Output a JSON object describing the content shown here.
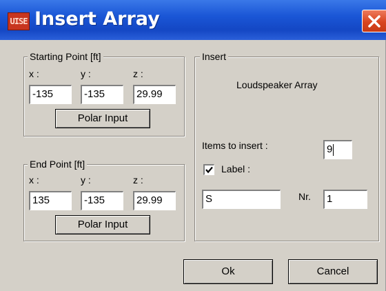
{
  "window": {
    "title": "Insert Array",
    "app_icon_text": "UISE",
    "close_icon": "close-x-icon",
    "accent_color": "#1a56d6",
    "close_color": "#d9451f"
  },
  "starting_point": {
    "legend": "Starting Point [ft]",
    "x_label": "x :",
    "y_label": "y :",
    "z_label": "z :",
    "x": "-135",
    "y": "-135",
    "z": "29.99",
    "polar_button": "Polar Input"
  },
  "end_point": {
    "legend": "End Point [ft]",
    "x_label": "x :",
    "y_label": "y :",
    "z_label": "z :",
    "x": "135",
    "y": "-135",
    "z": "29.99",
    "polar_button": "Polar Input"
  },
  "insert": {
    "legend": "Insert",
    "item_type": "Loudspeaker Array",
    "items_label": "Items to insert :",
    "items_value": "9",
    "label_checkbox_label": "Label :",
    "label_checked": true,
    "label_value": "S",
    "nr_label": "Nr.",
    "nr_value": "1"
  },
  "buttons": {
    "ok": "Ok",
    "cancel": "Cancel"
  }
}
